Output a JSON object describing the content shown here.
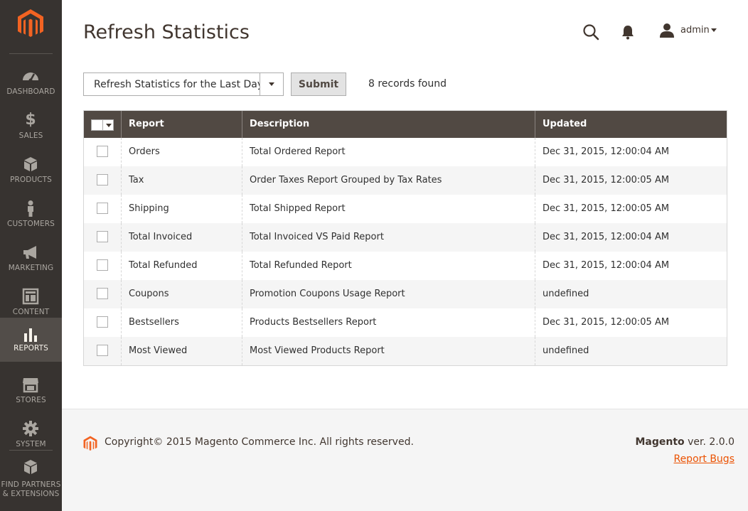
{
  "sidebar": {
    "logo_icon": "magento-logo-icon",
    "items": [
      {
        "label": "DASHBOARD",
        "icon": "dashboard-icon"
      },
      {
        "label": "SALES",
        "icon": "dollar-icon"
      },
      {
        "label": "PRODUCTS",
        "icon": "box-icon"
      },
      {
        "label": "CUSTOMERS",
        "icon": "person-icon"
      },
      {
        "label": "MARKETING",
        "icon": "megaphone-icon"
      },
      {
        "label": "CONTENT",
        "icon": "layout-icon"
      },
      {
        "label": "REPORTS",
        "icon": "bar-chart-icon",
        "active": true
      },
      {
        "label": "STORES",
        "icon": "store-icon"
      },
      {
        "label": "SYSTEM",
        "icon": "gear-icon"
      },
      {
        "label_line1": "FIND PARTNERS",
        "label_line2": "& EXTENSIONS",
        "icon": "partners-box-icon"
      }
    ]
  },
  "header": {
    "title": "Refresh Statistics",
    "user": "admin"
  },
  "controls": {
    "period_value": "Refresh Statistics for the Last Day",
    "submit_label": "Submit",
    "records_found": "8 records found"
  },
  "grid": {
    "columns": [
      "Report",
      "Description",
      "Updated"
    ],
    "rows": [
      {
        "report": "Orders",
        "description": "Total Ordered Report",
        "updated": "Dec 31, 2015, 12:00:04 AM"
      },
      {
        "report": "Tax",
        "description": "Order Taxes Report Grouped by Tax Rates",
        "updated": "Dec 31, 2015, 12:00:05 AM"
      },
      {
        "report": "Shipping",
        "description": "Total Shipped Report",
        "updated": "Dec 31, 2015, 12:00:05 AM"
      },
      {
        "report": "Total Invoiced",
        "description": "Total Invoiced VS Paid Report",
        "updated": "Dec 31, 2015, 12:00:04 AM"
      },
      {
        "report": "Total Refunded",
        "description": "Total Refunded Report",
        "updated": "Dec 31, 2015, 12:00:04 AM"
      },
      {
        "report": "Coupons",
        "description": "Promotion Coupons Usage Report",
        "updated": "undefined"
      },
      {
        "report": "Bestsellers",
        "description": "Products Bestsellers Report",
        "updated": "Dec 31, 2015, 12:00:05 AM"
      },
      {
        "report": "Most Viewed",
        "description": "Most Viewed Products Report",
        "updated": "undefined"
      }
    ]
  },
  "footer": {
    "copyright": "Copyright© 2015 Magento Commerce Inc. All rights reserved.",
    "brand": "Magento",
    "version": " ver. 2.0.0",
    "report_bugs": "Report Bugs"
  },
  "colors": {
    "sidebar_bg": "#373330",
    "sidebar_active": "#524d49",
    "grid_header": "#514943",
    "accent": "#eb5202"
  }
}
